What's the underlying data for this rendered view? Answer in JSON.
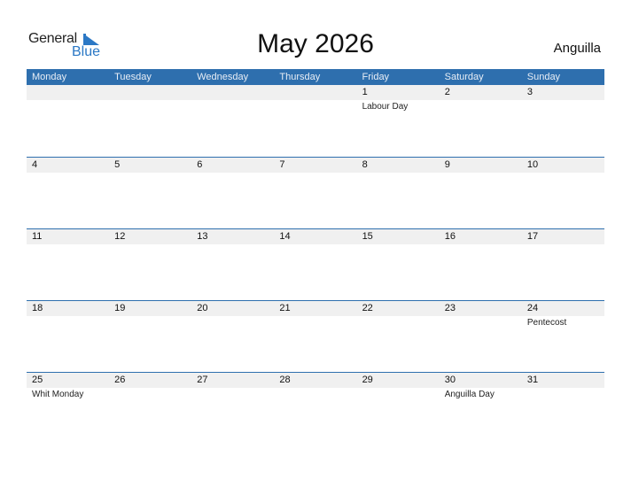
{
  "logo": {
    "line1": "General",
    "line2": "Blue"
  },
  "title": "May 2026",
  "country": "Anguilla",
  "colors": {
    "header_bg": "#2e6fae",
    "logo_blue": "#2b78c5",
    "strip_bg": "#f0f0f0"
  },
  "weekdays": [
    "Monday",
    "Tuesday",
    "Wednesday",
    "Thursday",
    "Friday",
    "Saturday",
    "Sunday"
  ],
  "weeks": [
    [
      {
        "day": "",
        "event": ""
      },
      {
        "day": "",
        "event": ""
      },
      {
        "day": "",
        "event": ""
      },
      {
        "day": "",
        "event": ""
      },
      {
        "day": "1",
        "event": "Labour Day"
      },
      {
        "day": "2",
        "event": ""
      },
      {
        "day": "3",
        "event": ""
      }
    ],
    [
      {
        "day": "4",
        "event": ""
      },
      {
        "day": "5",
        "event": ""
      },
      {
        "day": "6",
        "event": ""
      },
      {
        "day": "7",
        "event": ""
      },
      {
        "day": "8",
        "event": ""
      },
      {
        "day": "9",
        "event": ""
      },
      {
        "day": "10",
        "event": ""
      }
    ],
    [
      {
        "day": "11",
        "event": ""
      },
      {
        "day": "12",
        "event": ""
      },
      {
        "day": "13",
        "event": ""
      },
      {
        "day": "14",
        "event": ""
      },
      {
        "day": "15",
        "event": ""
      },
      {
        "day": "16",
        "event": ""
      },
      {
        "day": "17",
        "event": ""
      }
    ],
    [
      {
        "day": "18",
        "event": ""
      },
      {
        "day": "19",
        "event": ""
      },
      {
        "day": "20",
        "event": ""
      },
      {
        "day": "21",
        "event": ""
      },
      {
        "day": "22",
        "event": ""
      },
      {
        "day": "23",
        "event": ""
      },
      {
        "day": "24",
        "event": "Pentecost"
      }
    ],
    [
      {
        "day": "25",
        "event": "Whit Monday"
      },
      {
        "day": "26",
        "event": ""
      },
      {
        "day": "27",
        "event": ""
      },
      {
        "day": "28",
        "event": ""
      },
      {
        "day": "29",
        "event": ""
      },
      {
        "day": "30",
        "event": "Anguilla Day"
      },
      {
        "day": "31",
        "event": ""
      }
    ]
  ]
}
